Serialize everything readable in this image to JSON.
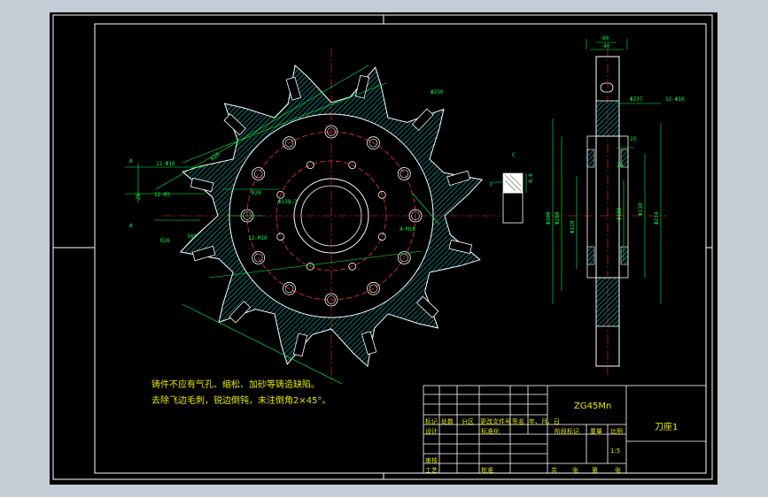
{
  "drawing": {
    "tech_notes": [
      "铸件不应有气孔、缩松、加砂等铸造缺陷。",
      "去除飞边毛刺，锐边倒钝，未注倒角2×45°。"
    ],
    "dims": {
      "outer_dia": "Φ330",
      "chamfer_label": "C",
      "r10": "R10",
      "r26": "R26",
      "n12_phi10": "12-Φ10",
      "n12_r5": "12-R5",
      "r20": "R20",
      "p30": "30°",
      "d26": "26",
      "pcd": "Φ138.3",
      "n4_m16": "4-M16",
      "n12_m10": "12-M10",
      "sec_a": "A",
      "sec_a2": "A",
      "w30": "3°",
      "w46": "4.6",
      "w60": "60",
      "w40": "40",
      "phi237": "Φ237",
      "n12_m16": "12-Φ16",
      "d15": "15",
      "d20": "20",
      "phi260": "Φ260",
      "phi180": "Φ180",
      "phi120": "Φ120",
      "phi300": "Φ300",
      "phi110": "Φ110",
      "phi214": "Φ214"
    }
  },
  "title_block": {
    "material": "ZG45Mn",
    "part_name": "刀座1",
    "scale_value": "1:5",
    "header_labels": [
      "标记",
      "处数",
      "分区",
      "更改文件号",
      "签名",
      "年、月、日"
    ],
    "row2_labels": [
      "设计",
      "标准化"
    ],
    "stage_label": "阶段标记",
    "weight_label": "重量",
    "scale_label": "比例",
    "row4_labels": [
      "审核"
    ],
    "row5_labels": [
      "工艺",
      "批准"
    ],
    "sheet_labels": [
      "共",
      "张",
      "第",
      "张"
    ]
  }
}
